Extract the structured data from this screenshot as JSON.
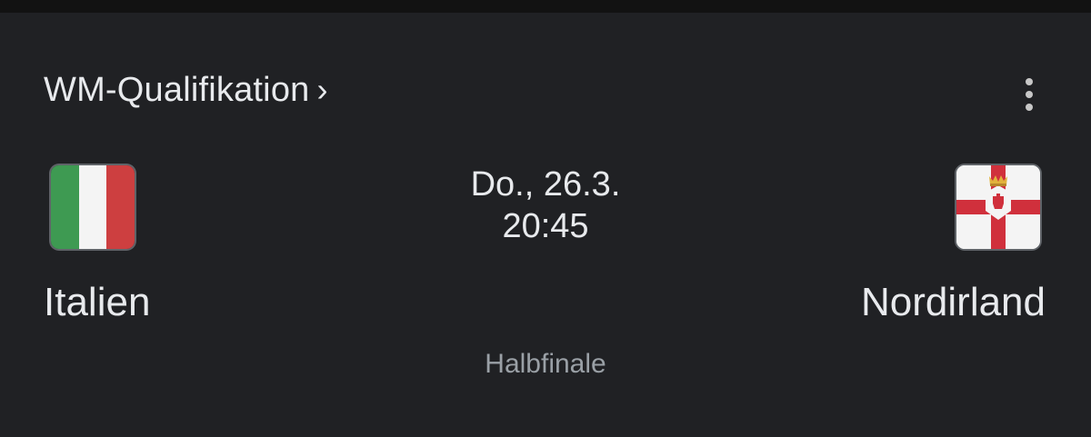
{
  "competition": {
    "label": "WM-Qualifikation",
    "chevron": "›"
  },
  "match": {
    "date": "Do., 26.3.",
    "time": "20:45",
    "stage": "Halbfinale"
  },
  "home_team": {
    "name": "Italien",
    "flag_icon": "italy-flag-icon",
    "flag_colors": [
      "#3e9a52",
      "#f4f4f4",
      "#cd3f40"
    ]
  },
  "away_team": {
    "name": "Nordirland",
    "flag_icon": "northern-ireland-flag-icon",
    "flag_colors": [
      "#f4f4f4",
      "#d0303c",
      "#e2b23b"
    ]
  },
  "menu": {
    "icon": "more-vert-icon"
  }
}
